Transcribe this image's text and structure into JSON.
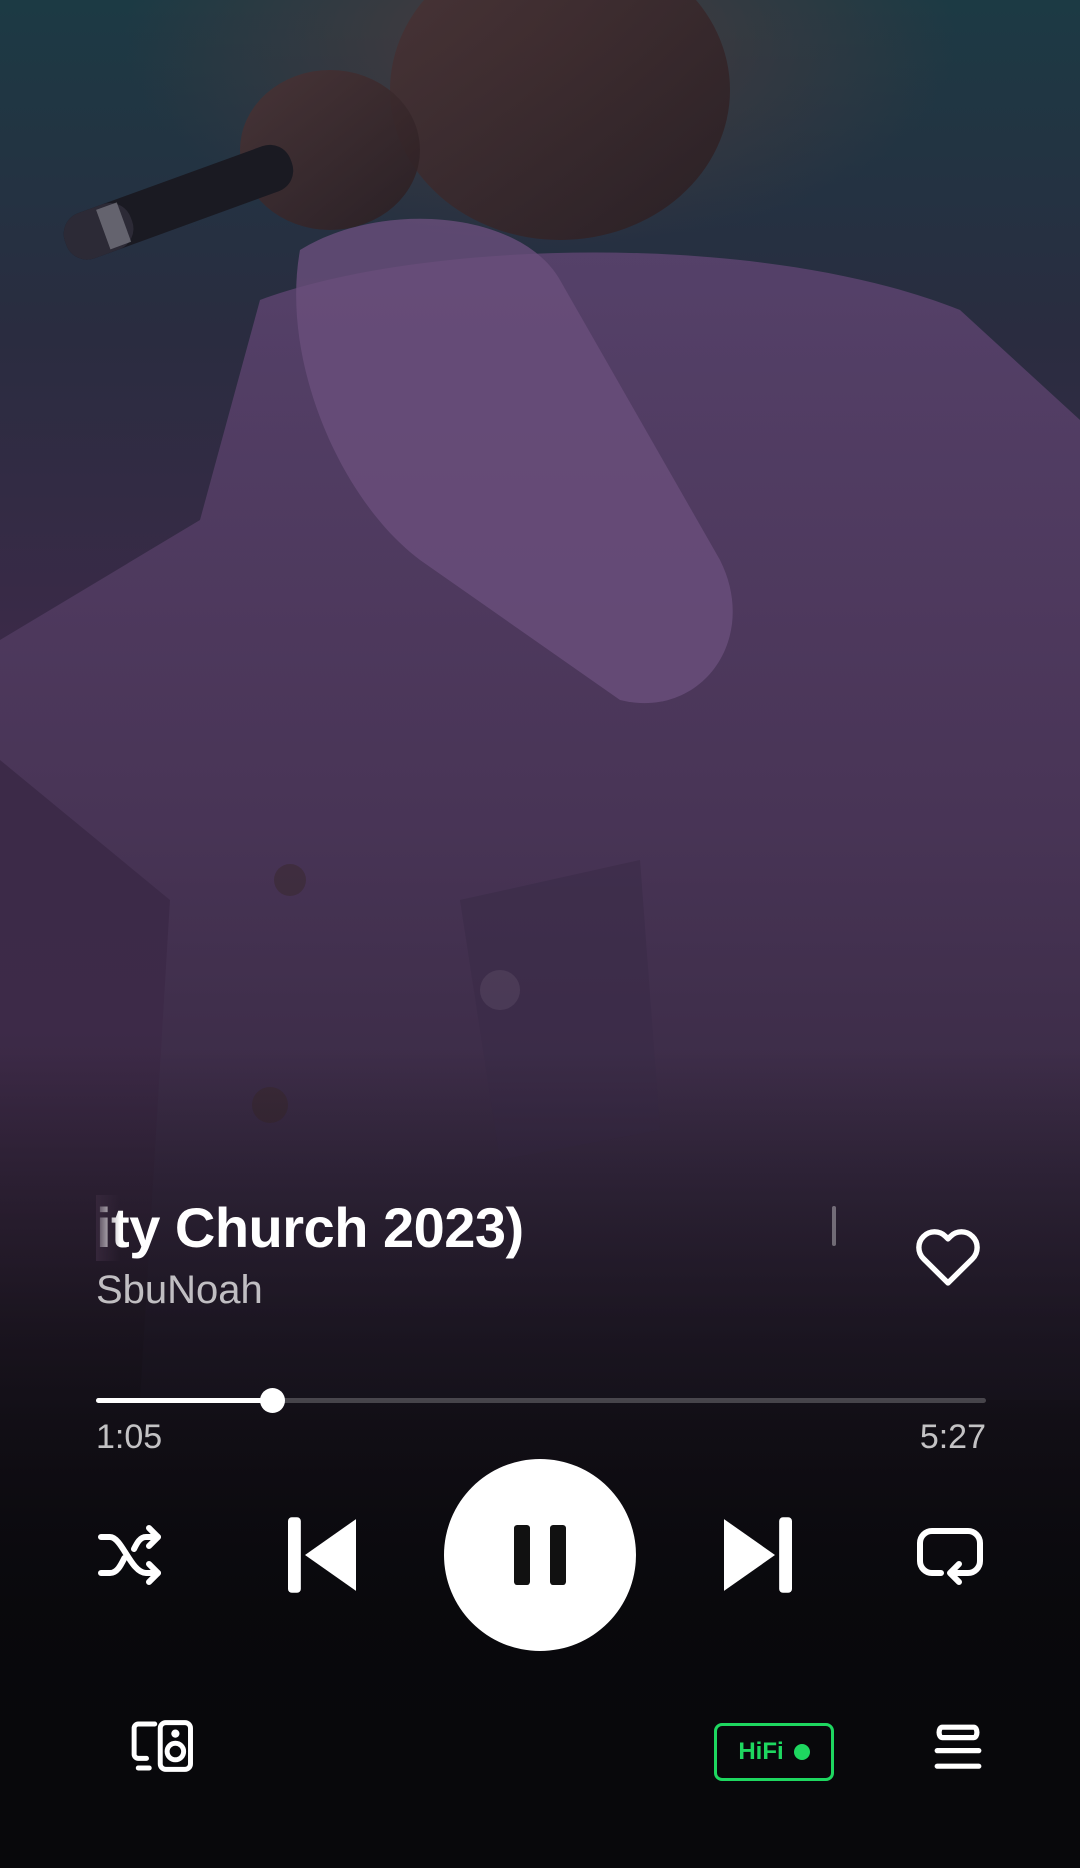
{
  "now_playing": {
    "title_visible": "ity Church 2023)",
    "artist": "SbuNoah",
    "liked": false
  },
  "progress": {
    "elapsed": "1:05",
    "total": "5:27",
    "fraction": 0.198
  },
  "controls": {
    "shuffle_icon": "shuffle-icon",
    "previous_icon": "skip-previous-icon",
    "play_state": "playing",
    "play_icon": "pause-icon",
    "next_icon": "skip-next-icon",
    "repeat_icon": "repeat-icon"
  },
  "bottom_bar": {
    "devices_icon": "connect-devices-icon",
    "hifi_label": "HiFi",
    "queue_icon": "queue-icon"
  },
  "colors": {
    "accent": "#1ed760",
    "text_primary": "#ffffff"
  }
}
